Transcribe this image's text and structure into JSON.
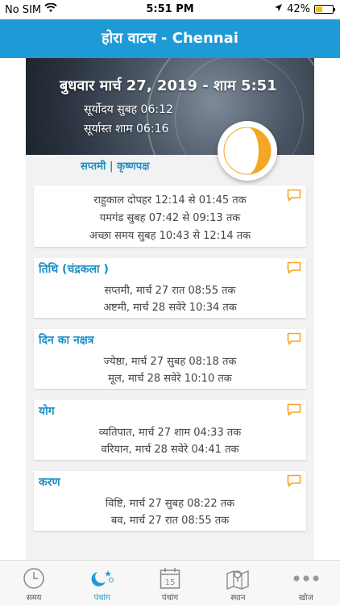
{
  "status_bar": {
    "carrier": "No SIM",
    "time": "5:51 PM",
    "battery": "42%"
  },
  "header": {
    "title": "होरा वाटच - Chennai"
  },
  "hero": {
    "date": "बुधवार मार्च 27, 2019 - शाम 5:51",
    "sunrise": "सूर्योदय सुबह 06:12",
    "sunset": "सूर्यास्त शाम 06:16"
  },
  "tithi_link": "सप्तमी | कृष्णपक्ष",
  "cards": [
    {
      "title": "",
      "lines": [
        "राहुकाल दोपहर 12:14 से 01:45 तक",
        "यमगंड सुबह 07:42 से 09:13 तक",
        "अच्छा समय सुबह 10:43 से 12:14 तक"
      ]
    },
    {
      "title": "तिथि (चंद्रकला )",
      "lines": [
        "सप्तमी, मार्च 27 रात 08:55 तक",
        "अष्टमी, मार्च 28 सवेरे 10:34  तक"
      ]
    },
    {
      "title": "दिन का नक्षत्र",
      "lines": [
        "ज्येष्ठा, मार्च 27 सुबह 08:18 तक",
        "मूल, मार्च 28 सवेरे 10:10 तक"
      ]
    },
    {
      "title": "योग",
      "lines": [
        "व्यतिपात, मार्च 27 शाम 04:33 तक",
        "वरियान, मार्च 28 सवेरे 04:41 तक"
      ]
    },
    {
      "title": "करण",
      "lines": [
        "विष्टि, मार्च 27 सुबह 08:22 तक",
        "बव, मार्च 27 रात 08:55 तक"
      ]
    }
  ],
  "tabs": [
    {
      "label": "समय",
      "icon": "clock-icon"
    },
    {
      "label": "पंचांग",
      "icon": "moon-stars-icon"
    },
    {
      "label": "पंचांग",
      "icon": "calendar-icon",
      "day": "15"
    },
    {
      "label": "स्थान",
      "icon": "map-icon"
    },
    {
      "label": "खोज",
      "icon": "more-icon"
    }
  ],
  "colors": {
    "header": "#1e9bd7",
    "accent": "#f5a623",
    "link": "#1e8fc8",
    "active_tab": "#1e9bd7"
  }
}
